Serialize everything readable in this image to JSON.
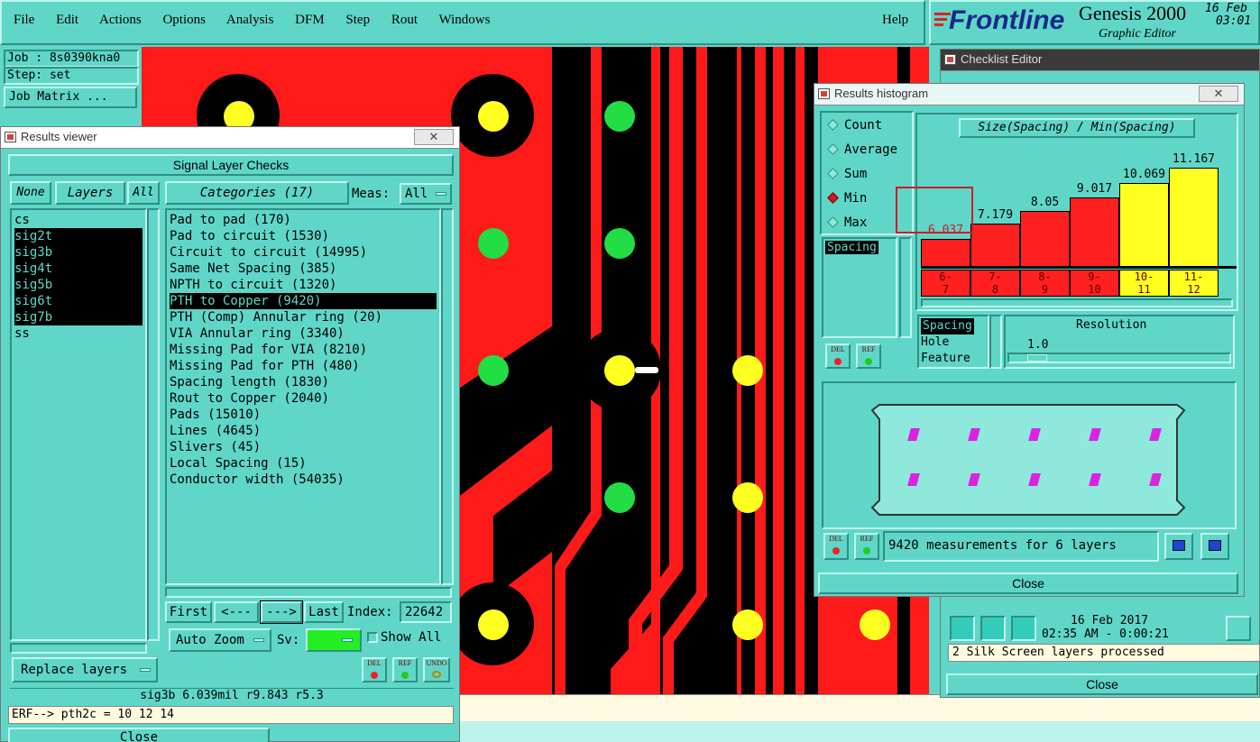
{
  "menu": {
    "items": [
      "File",
      "Edit",
      "Actions",
      "Options",
      "Analysis",
      "DFM",
      "Step",
      "Rout",
      "Windows"
    ],
    "help": "Help"
  },
  "brand": {
    "logo": "Frontline",
    "product": "Genesis 2000",
    "subtitle": "Graphic Editor",
    "date": "16 Feb",
    "time": "03:01"
  },
  "job": {
    "job_line": "Job : 8s0390kna0",
    "step_line": "Step: set",
    "matrix_button": "Job Matrix ..."
  },
  "results_viewer": {
    "title": "Results viewer",
    "header": "Signal Layer Checks",
    "none_btn": "None",
    "layers_tab": "Layers",
    "all_btn": "All",
    "categories_tab": "Categories (17)",
    "meas_label": "Meas:",
    "meas_value": "All",
    "layers": [
      {
        "name": "cs",
        "selected": false
      },
      {
        "name": "sig2t",
        "selected": true
      },
      {
        "name": "sig3b",
        "selected": true
      },
      {
        "name": "sig4t",
        "selected": true
      },
      {
        "name": "sig5b",
        "selected": true
      },
      {
        "name": "sig6t",
        "selected": true
      },
      {
        "name": "sig7b",
        "selected": true
      },
      {
        "name": "ss",
        "selected": false
      }
    ],
    "categories": [
      {
        "label": "Pad to pad (170)",
        "selected": false
      },
      {
        "label": "Pad to circuit (1530)",
        "selected": false
      },
      {
        "label": "Circuit to circuit (14995)",
        "selected": false
      },
      {
        "label": "Same Net Spacing (385)",
        "selected": false
      },
      {
        "label": "NPTH to circuit (1320)",
        "selected": false
      },
      {
        "label": "PTH to Copper (9420)",
        "selected": true
      },
      {
        "label": "PTH (Comp) Annular ring (20)",
        "selected": false
      },
      {
        "label": "VIA Annular ring (3340)",
        "selected": false
      },
      {
        "label": "Missing Pad for VIA (8210)",
        "selected": false
      },
      {
        "label": "Missing Pad for PTH (480)",
        "selected": false
      },
      {
        "label": "Spacing length (1830)",
        "selected": false
      },
      {
        "label": "Rout to Copper (2040)",
        "selected": false
      },
      {
        "label": "Pads (15010)",
        "selected": false
      },
      {
        "label": "Lines (4645)",
        "selected": false
      },
      {
        "label": "Slivers (45)",
        "selected": false
      },
      {
        "label": "Local Spacing (15)",
        "selected": false
      },
      {
        "label": "Conductor width (54035)",
        "selected": false
      }
    ],
    "first_btn": "First",
    "prev_btn": "<---",
    "next_btn": "--->",
    "last_btn": "Last",
    "index_label": "Index:",
    "index_value": "22642",
    "zoom_value": "Auto Zoom",
    "sv_label": "Sv:",
    "show_all_label": "Show All",
    "replace_btn": "Replace layers",
    "del_label": "DEL",
    "ref_label": "REF",
    "undo_label": "UNDO",
    "status": "sig3b 6.039mil  r9.843  r5.3",
    "erf": "ERF--> pth2c = 10 12 14",
    "close": "Close"
  },
  "histogram": {
    "title": "Results histogram",
    "options": [
      {
        "label": "Count",
        "on": false
      },
      {
        "label": "Average",
        "on": false
      },
      {
        "label": "Sum",
        "on": false
      },
      {
        "label": "Min",
        "on": true
      },
      {
        "label": "Max",
        "on": false
      }
    ],
    "chart_title": "Size(Spacing) / Min(Spacing)",
    "spacing_item": "Spacing",
    "bars": [
      {
        "value": "6.037",
        "top": "6-",
        "bottom": "7",
        "color": "#ff2020"
      },
      {
        "value": "7.179",
        "top": "7-",
        "bottom": "8",
        "color": "#ff2020"
      },
      {
        "value": "8.05",
        "top": "8-",
        "bottom": "9",
        "color": "#ff2020"
      },
      {
        "value": "9.017",
        "top": "9-",
        "bottom": "10",
        "color": "#ff2020"
      },
      {
        "value": "10.069",
        "top": "10-",
        "bottom": "11",
        "color": "#ffff20"
      },
      {
        "value": "11.167",
        "top": "11-",
        "bottom": "12",
        "color": "#ffff20"
      }
    ],
    "attr_items": [
      "Spacing",
      "Hole",
      "Feature"
    ],
    "resolution_label": "Resolution",
    "resolution_value": "1.0",
    "measurements": "9420 measurements for 6 layers",
    "close": "Close"
  },
  "checklist": {
    "title": "Checklist Editor",
    "date": "16 Feb 2017",
    "time": "02:35 AM - 0:00:21",
    "status": "2 Silk Screen layers processed",
    "close": "Close"
  },
  "colors": {
    "teal": "#5fd6c8",
    "copper": "#ff1a1a",
    "pad_yellow": "#ffff22",
    "via_green": "#22dd44"
  }
}
